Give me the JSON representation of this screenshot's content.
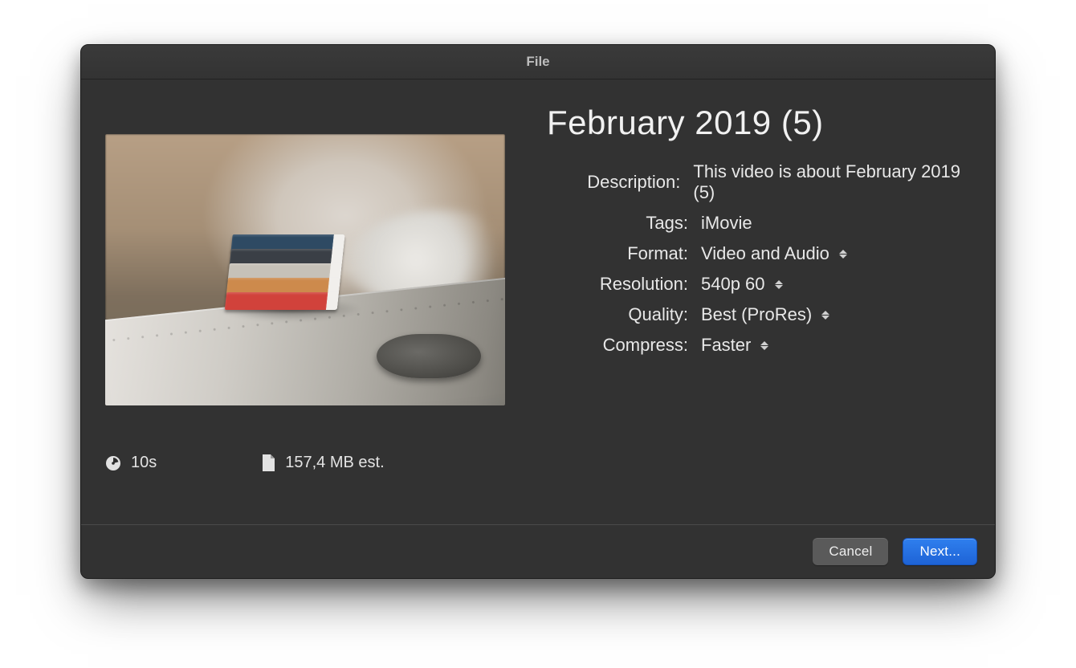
{
  "window": {
    "title": "File"
  },
  "project": {
    "title": "February 2019 (5)"
  },
  "form": {
    "description": {
      "label": "Description:",
      "value": "This video is about February 2019 (5)"
    },
    "tags": {
      "label": "Tags:",
      "value": "iMovie"
    },
    "format": {
      "label": "Format:",
      "value": "Video and Audio"
    },
    "resolution": {
      "label": "Resolution:",
      "value": "540p 60"
    },
    "quality": {
      "label": "Quality:",
      "value": "Best (ProRes)"
    },
    "compress": {
      "label": "Compress:",
      "value": "Faster"
    }
  },
  "stats": {
    "duration": "10s",
    "filesize": "157,4 MB est."
  },
  "buttons": {
    "cancel": "Cancel",
    "next": "Next..."
  }
}
